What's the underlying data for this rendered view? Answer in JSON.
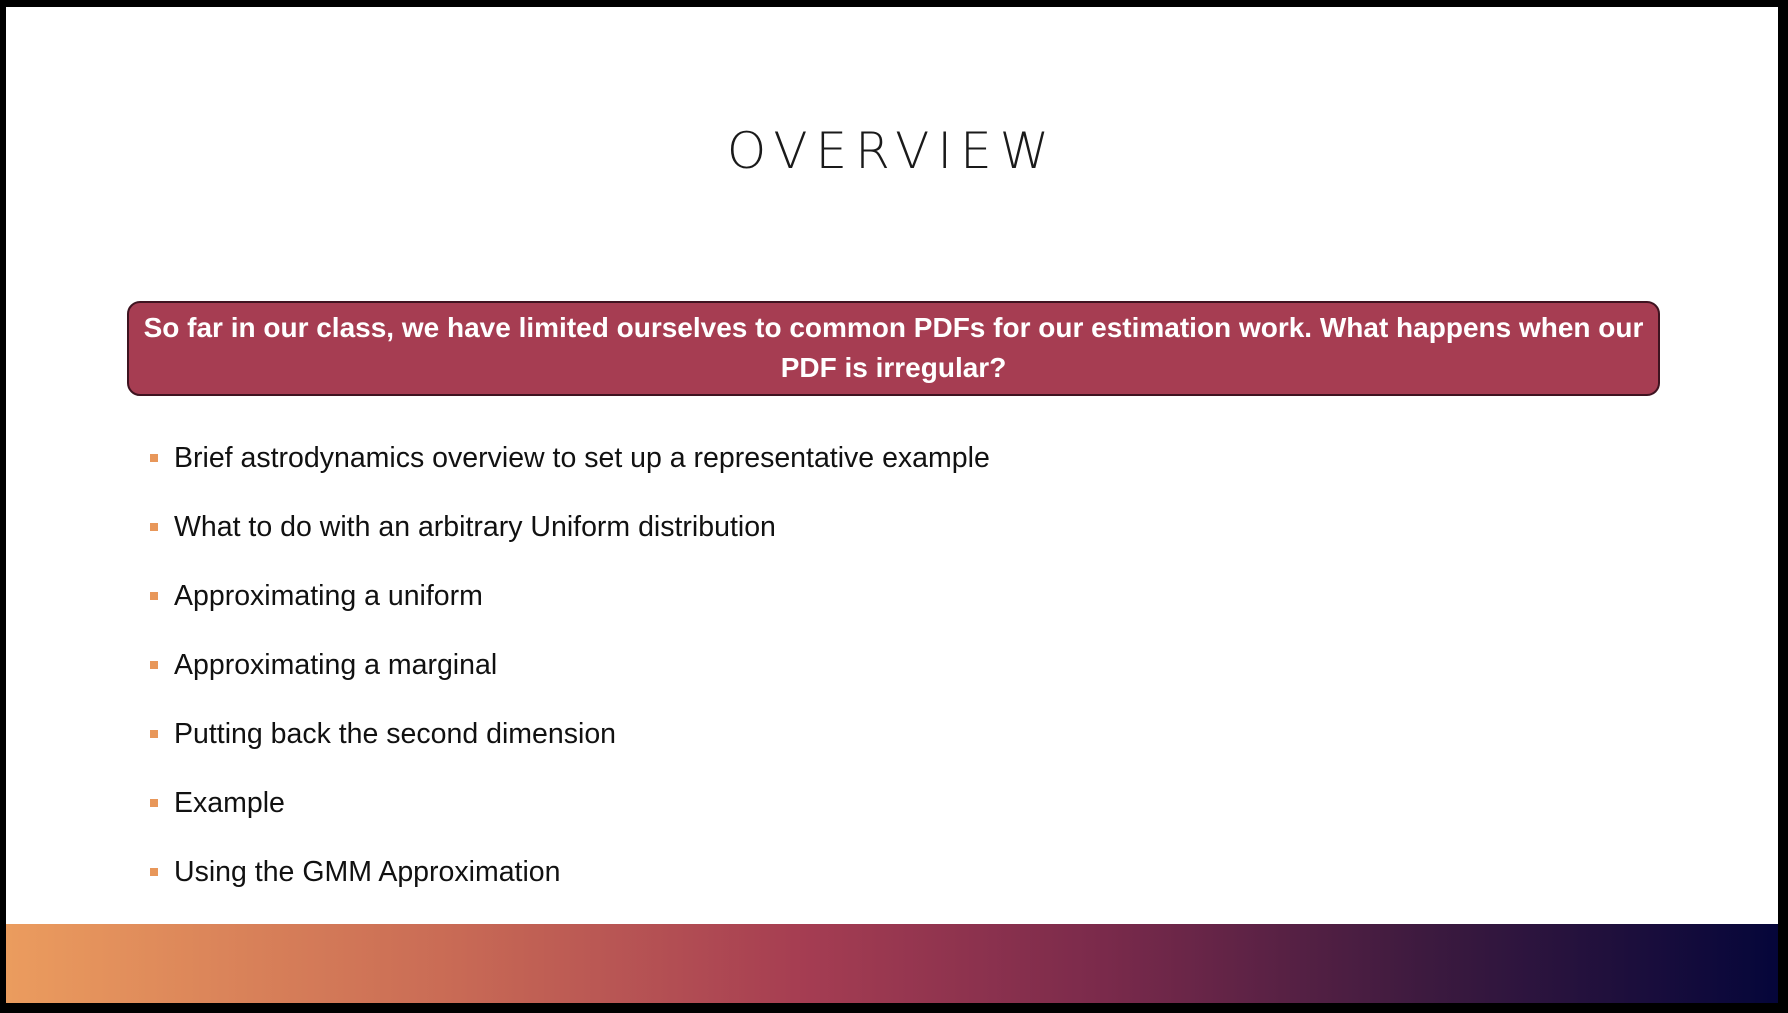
{
  "slide": {
    "title": "OVERVIEW",
    "callout": "So far in our class, we have limited ourselves to common PDFs for our estimation work. What happens when our PDF is irregular?",
    "bullets": [
      "Brief astrodynamics overview to set up a representative example",
      "What to do with an arbitrary Uniform distribution",
      "Approximating a uniform",
      "Approximating a marginal",
      "Putting back the second dimension",
      "Example",
      "Using the GMM Approximation"
    ]
  },
  "colors": {
    "callout_fill": "#a63d52",
    "bullet_marker": "#e8975a",
    "band_start": "#eb9c5e",
    "band_mid": "#a53d52",
    "band_end": "#05063a"
  },
  "icons": {
    "bullet": "square-bullet-icon"
  }
}
